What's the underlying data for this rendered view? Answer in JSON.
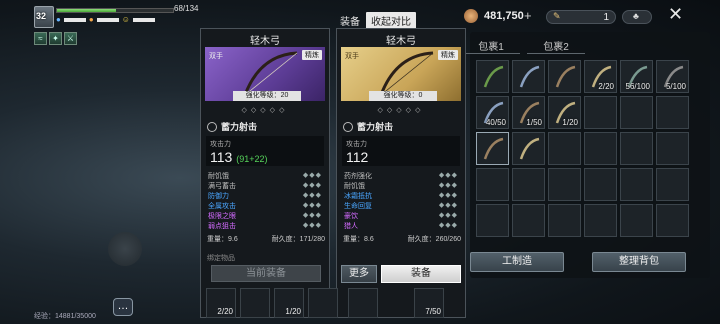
{
  "hud": {
    "level": "32",
    "hp_text": "68/134",
    "hp_fraction": 0.51,
    "exp_label": "经验：14881/35000"
  },
  "currency": {
    "coins": "481,750",
    "plus": "+",
    "scrolls": "1"
  },
  "compare": {
    "equip_label": "装备",
    "toggle_label": "收起对比"
  },
  "left_card": {
    "title": "轻木弓",
    "tag_hand": "双手",
    "tag_quality": "精炼",
    "enhance": "强化等级：20",
    "skill": "蓄力射击",
    "atk_label": "攻击力",
    "atk_value": "113",
    "atk_bonus": "(91+22)",
    "attrs": [
      {
        "name": "耐饥饿",
        "cls": "c-grey"
      },
      {
        "name": "满弓蓄击",
        "cls": "c-grey"
      },
      {
        "name": "防御力",
        "cls": "c-blue"
      },
      {
        "name": "全属攻击",
        "cls": "c-blue"
      },
      {
        "name": "极限之眼",
        "cls": "c-purple"
      },
      {
        "name": "弱点狙击",
        "cls": "c-purple"
      }
    ],
    "weight": "重量：9.6",
    "durability": "耐久度：171/280",
    "bind": "绑定物品",
    "button": "当前装备"
  },
  "right_card": {
    "title": "轻木弓",
    "tag_hand": "双手",
    "tag_quality": "精炼",
    "enhance": "强化等级：0",
    "skill": "蓄力射击",
    "atk_label": "攻击力",
    "atk_value": "112",
    "attrs": [
      {
        "name": "药剂强化",
        "cls": "c-grey"
      },
      {
        "name": "耐饥饿",
        "cls": "c-grey"
      },
      {
        "name": "冰霜抵抗",
        "cls": "c-blue"
      },
      {
        "name": "生命回复",
        "cls": "c-blue"
      },
      {
        "name": "豪饮",
        "cls": "c-purple"
      },
      {
        "name": "猎人",
        "cls": "c-purple"
      }
    ],
    "weight": "重量：8.6",
    "durability": "耐久度：260/260",
    "more": "更多",
    "equip": "装备"
  },
  "bag": {
    "tab1": "包裹1",
    "tab2": "包裹2",
    "slots_row1": [
      "",
      "",
      "",
      "2/20",
      "56/100",
      "5/100"
    ],
    "slots_row2": [
      "40/50",
      "1/50",
      "1/20",
      "",
      "",
      ""
    ],
    "craft_btn": "工制造",
    "sort_btn": "整理背包"
  },
  "hotbar": [
    "2/20",
    "",
    "1/20",
    "",
    "",
    "7/50"
  ]
}
